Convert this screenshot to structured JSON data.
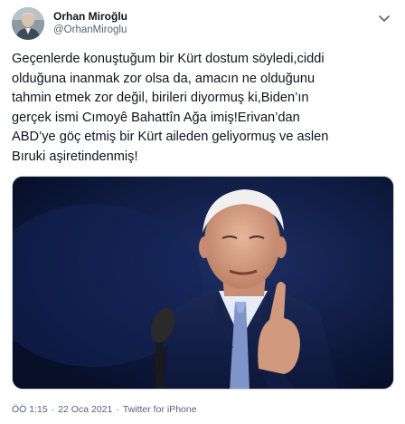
{
  "tweet": {
    "author": {
      "display_name": "Orhan Miroğlu",
      "handle": "@OrhanMiroglu",
      "avatar_icon": "profile-photo"
    },
    "menu_icon": "chevron-down-icon",
    "text_lines": [
      "Geçenlerde konuştuğum bir Kürt dostum söyledi,ciddi",
      "olduğuna inanmak zor olsa da, amacın ne olduğunu",
      "tahmin etmek zor değil, birileri diyormuş ki,Biden’ın",
      "gerçek ismi Cımoyê Bahattîn Ağa imiş!Erivan’dan",
      "ABD’ye göç etmiş bir Kürt aileden geliyormuş ve aslen",
      "Bıruki aşiretindenmiş!"
    ],
    "media": {
      "description_icon": "photo-man-speaking-at-microphone"
    },
    "meta": {
      "time": "ÖÖ 1:15",
      "separator_1": "·",
      "date": "22 Oca 2021",
      "separator_2": "·",
      "source": "Twitter for iPhone"
    }
  },
  "colors": {
    "text_primary": "#0f1419",
    "text_secondary": "#536471",
    "border": "#cfd9de",
    "photo_background": "#0c1a3d"
  }
}
